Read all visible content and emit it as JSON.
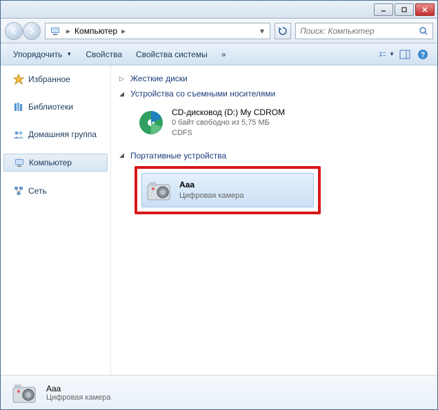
{
  "address": {
    "segment": "Компьютер"
  },
  "search": {
    "placeholder": "Поиск: Компьютер"
  },
  "toolbar": {
    "organize": "Упорядочить",
    "properties": "Свойства",
    "system_properties": "Свойства системы"
  },
  "sidebar": {
    "favorites": "Избранное",
    "libraries": "Библиотеки",
    "homegroup": "Домашняя группа",
    "computer": "Компьютер",
    "network": "Сеть"
  },
  "groups": {
    "hard_drives": "Жесткие диски",
    "removable": "Устройства со съемными носителями",
    "portable": "Портативные устройства"
  },
  "devices": {
    "cdrom": {
      "name": "CD-дисковод (D:) My CDROM",
      "free": "0 байт свободно из 5,75 МБ",
      "fs": "CDFS"
    },
    "camera": {
      "name": "Aaa",
      "type": "Цифровая камера"
    }
  },
  "status": {
    "name": "Aaa",
    "type": "Цифровая камера"
  }
}
